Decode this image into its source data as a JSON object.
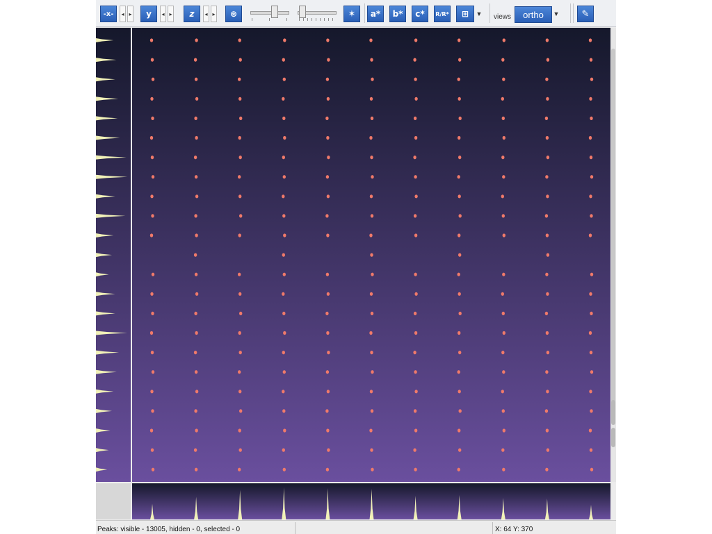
{
  "toolbar": {
    "x_axis_label": "-x-",
    "y_axis_label": "y",
    "z_axis_label": "z",
    "a_star_label": "a*",
    "b_star_label": "b*",
    "c_star_label": "c*",
    "rr_label": "R/R*",
    "views_label": "views",
    "views_value": "ortho",
    "icons": [
      "x-axis-icon",
      "y-axis-icon",
      "z-axis-icon",
      "reciprocal-sphere-icon",
      "slider-icon",
      "slider-icon",
      "star-icon",
      "a-star-icon",
      "b-star-icon",
      "c-star-icon",
      "r-r-star-icon",
      "lattice-icon",
      "wrench-icon"
    ]
  },
  "status": {
    "peaks_text": "Peaks: visible - 13005, hidden - 0, selected - 0",
    "coords_text": "X: 64  Y: 370"
  },
  "colors": {
    "view_top": "#15182b",
    "view_bottom": "#6a4f9e",
    "peak": "#f07a6a",
    "profile_fill": "#f1f1b8",
    "toolbar_accent": "#2f6fcb"
  },
  "view": {
    "columns": 11,
    "rows": 23,
    "missing_cells": [
      [
        11,
        0
      ],
      [
        11,
        2
      ],
      [
        11,
        4
      ],
      [
        11,
        6
      ],
      [
        11,
        8
      ],
      [
        11,
        10
      ]
    ]
  },
  "profiles": {
    "left_peak_lengths": [
      0.55,
      0.64,
      0.6,
      0.7,
      0.68,
      0.75,
      0.95,
      0.98,
      0.6,
      0.92,
      0.55,
      0.5,
      0.4,
      0.6,
      0.6,
      0.98,
      0.72,
      0.65,
      0.55,
      0.5,
      0.45,
      0.4,
      0.35
    ],
    "bottom_peak_heights": [
      0.45,
      0.65,
      0.85,
      0.92,
      0.9,
      0.88,
      0.68,
      0.7,
      0.62,
      0.6,
      0.42
    ]
  }
}
